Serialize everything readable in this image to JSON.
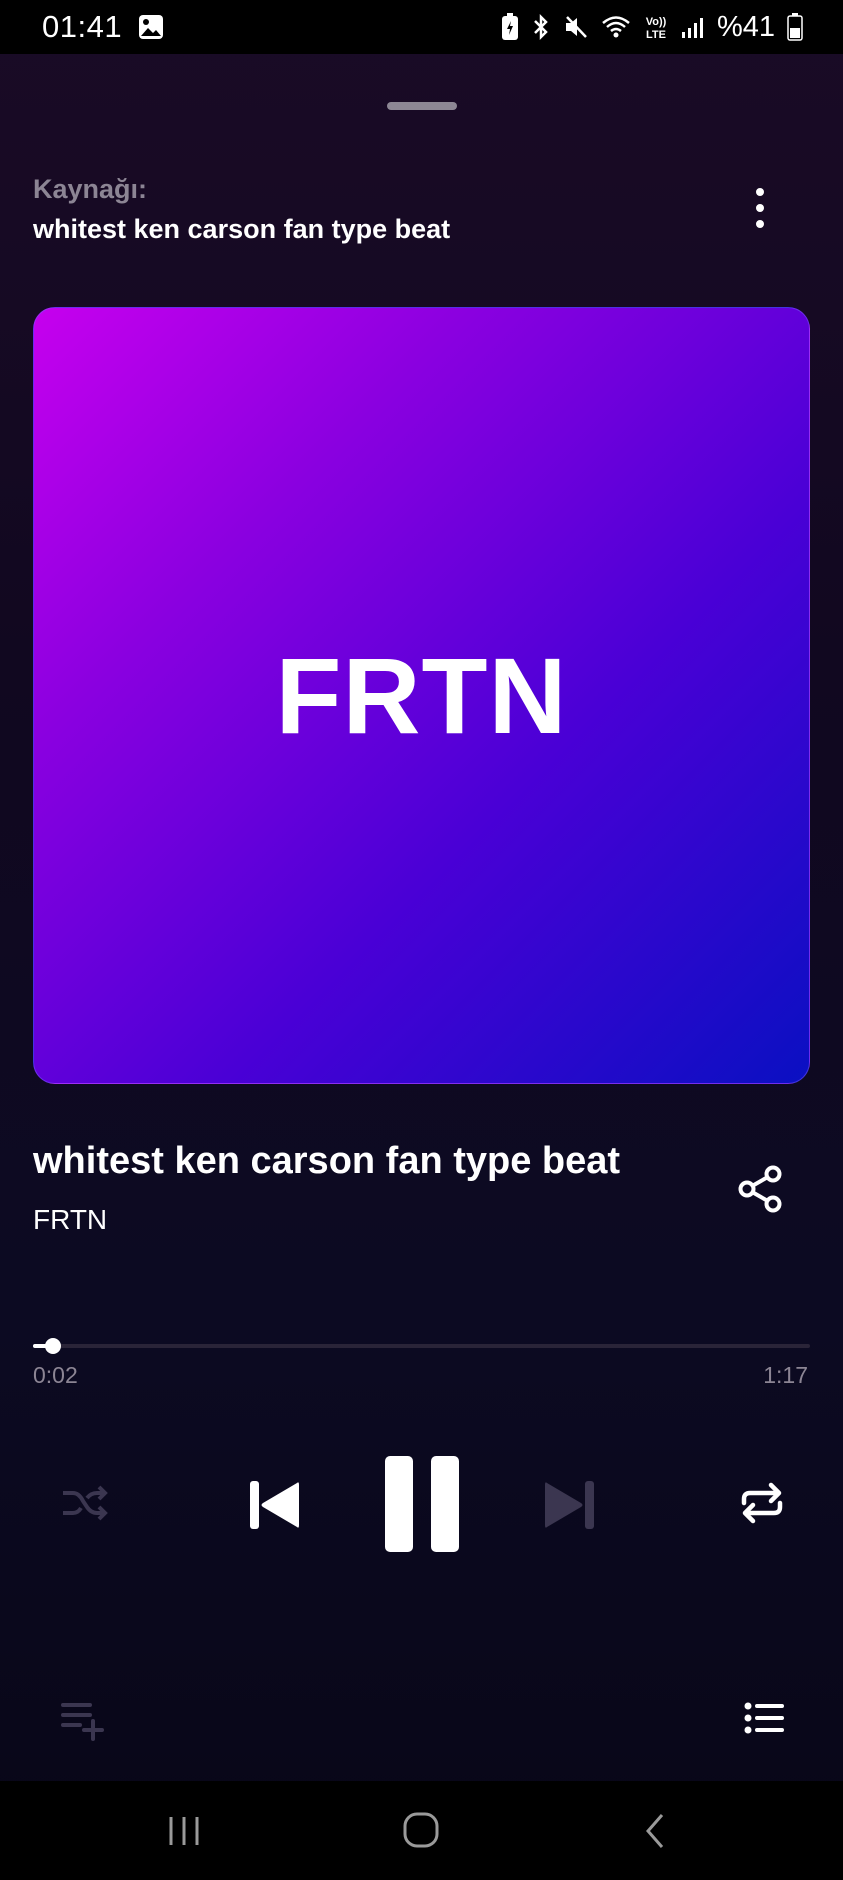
{
  "status_bar": {
    "time": "01:41",
    "battery_text": "%41"
  },
  "source": {
    "label": "Kaynağı:",
    "value": "whitest ken carson fan type beat"
  },
  "artwork": {
    "text": "FRTN"
  },
  "track": {
    "title": "whitest ken carson fan type beat",
    "artist": "FRTN"
  },
  "playback": {
    "elapsed": "0:02",
    "total": "1:17",
    "progress_fraction": 0.026,
    "state": "playing"
  },
  "icons": {
    "status": [
      "gallery-icon",
      "battery-saver-icon",
      "bluetooth-icon",
      "mute-icon",
      "wifi-icon",
      "volte-icon",
      "signal-icon",
      "battery-icon"
    ],
    "controls": [
      "shuffle-icon",
      "previous-icon",
      "pause-icon",
      "next-icon",
      "repeat-icon",
      "add-to-queue-icon",
      "queue-list-icon"
    ],
    "header": [
      "more-vertical-icon",
      "share-icon"
    ],
    "nav": [
      "recents-icon",
      "home-icon",
      "back-icon"
    ]
  },
  "colors": {
    "accent_start": "#c600ee",
    "accent_end": "#0a10c2",
    "muted_text": "#8c8594",
    "disabled_icon": "#3b3650"
  }
}
